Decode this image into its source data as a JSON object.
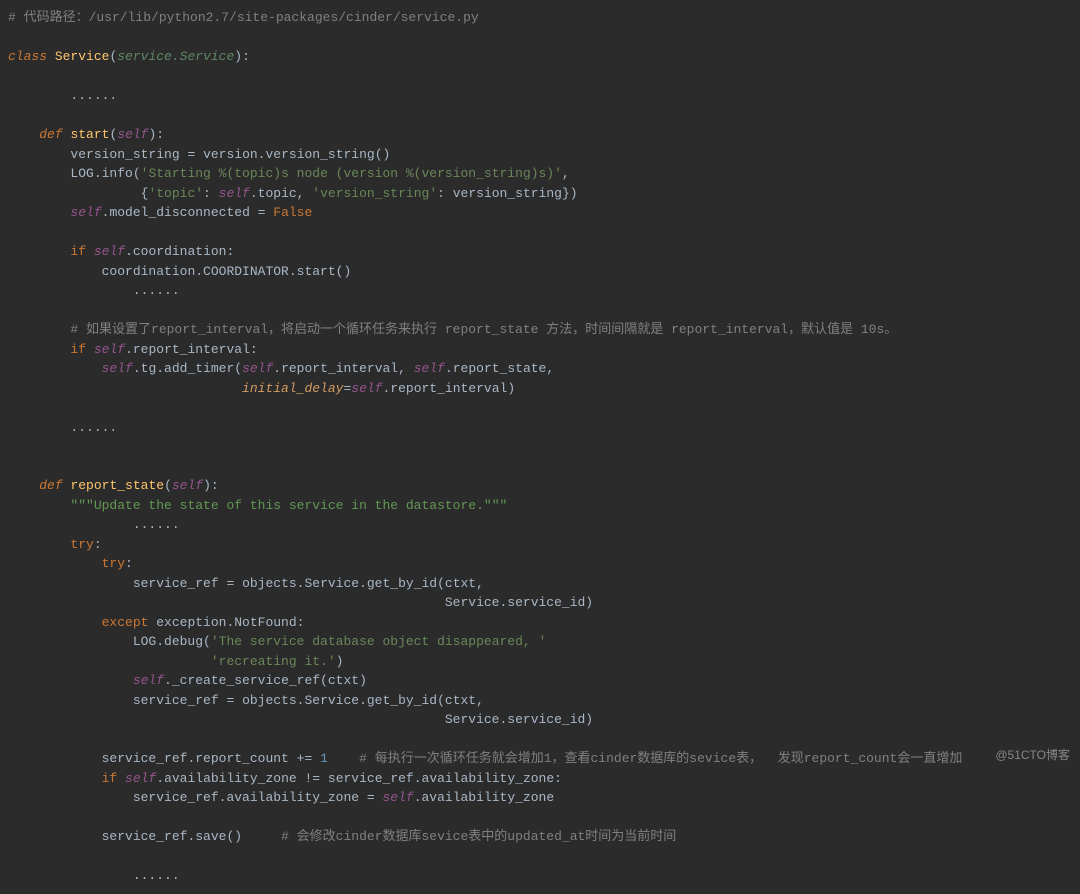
{
  "watermark": "@51CTO博客",
  "code": {
    "l01_comment": "# 代码路径：/usr/lib/python2.7/site-packages/cinder/service.py",
    "l02_class": "class",
    "l02_Service": "Service",
    "l02_base": "service.Service",
    "l03_dots": "......",
    "l04_def": "def",
    "l04_start": "start",
    "l04_self": "self",
    "l05_vs": "version_string",
    "l05_eq": "=",
    "l05_call": "version.version_string()",
    "l06_log": "LOG.info(",
    "l06_str": "'Starting %(topic)s node (version %(version_string)s)'",
    "l06_comma": ",",
    "l07_dict_open": "{",
    "l07_k1": "'topic'",
    "l07_colon1": ": ",
    "l07_v1": "self",
    "l07_v1b": ".topic, ",
    "l07_k2": "'version_string'",
    "l07_colon2": ": ",
    "l07_v2": "version_string})",
    "l08_self": "self",
    "l08_attr": ".model_disconnected ",
    "l08_eq": "= ",
    "l08_false": "False",
    "l09_if": "if",
    "l09_self": "self",
    "l09_coord": ".coordination:",
    "l10_call": "coordination.COORDINATOR.start()",
    "l10_dots": "......",
    "l11_comment": "# 如果设置了report_interval，将启动一个循环任务来执行 report_state 方法，时间间隔就是 report_interval，默认值是 10s。",
    "l12_if": "if",
    "l12_self": "self",
    "l12_ri": ".report_interval:",
    "l13_self": "self",
    "l13_tg": ".tg.add_timer(",
    "l13_self2": "self",
    "l13_a1": ".report_interval, ",
    "l13_self3": "self",
    "l13_a2": ".report_state,",
    "l14_param": "initial_delay",
    "l14_eq": "=",
    "l14_self": "self",
    "l14_ri": ".report_interval)",
    "l15_dots": "......",
    "l16_def": "def",
    "l16_rs": "report_state",
    "l16_self": "self",
    "l17_doc": "\"\"\"Update the state of this service in the datastore.\"\"\"",
    "l17_dots": "......",
    "l18_try": "try",
    "l19_try": "try",
    "l20_sr": "service_ref ",
    "l20_eq": "= ",
    "l20_call": "objects.Service.get_by_id(ctxt,",
    "l21_tail": "Service.service_id)",
    "l22_except": "except",
    "l22_exc": " exception.NotFound:",
    "l23_log": "LOG.debug(",
    "l23_s1": "'The service database object disappeared, '",
    "l24_s2": "'recreating it.'",
    "l24_close": ")",
    "l25_self": "self",
    "l25_cr": "._create_service_ref(ctxt)",
    "l26_sr": "service_ref ",
    "l26_eq": "= ",
    "l26_call": "objects.Service.get_by_id(ctxt,",
    "l27_tail": "Service.service_id)",
    "l28_sr": "service_ref.report_count ",
    "l28_op": "+= ",
    "l28_one": "1",
    "l28_comment": "    # 每执行一次循环任务就会增加1，查看cinder数据库的sevice表，  发现report_count会一直增加",
    "l29_if": "if",
    "l29_self": "self",
    "l29_az": ".availability_zone ",
    "l29_ne": "!= ",
    "l29_sraz": "service_ref.availability_zone:",
    "l30_sraz": "service_ref.availability_zone ",
    "l30_eq": "= ",
    "l30_self": "self",
    "l30_az": ".availability_zone",
    "l31_save": "service_ref.save()",
    "l31_comment": "     # 会修改cinder数据库sevice表中的updated_at时间为当前时间",
    "l32_dots": "......"
  }
}
